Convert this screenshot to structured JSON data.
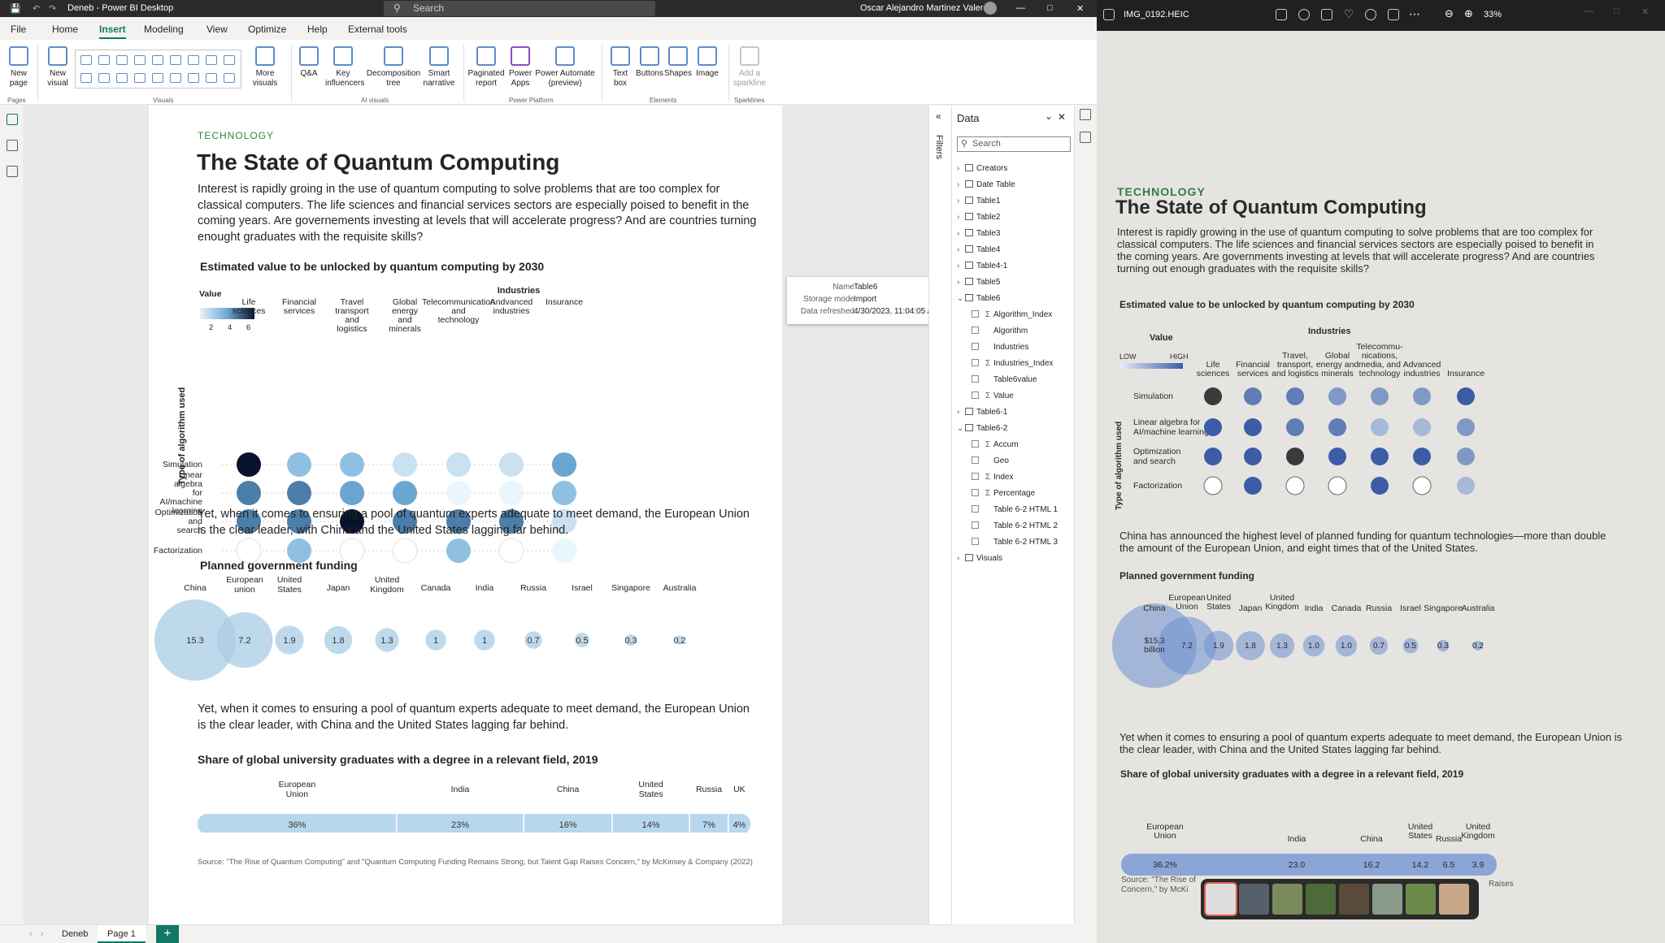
{
  "app": {
    "title": "Deneb - Power BI Desktop",
    "search_placeholder": "Search",
    "user": "Oscar Alejandro Martinez Valero"
  },
  "menu": [
    "File",
    "Home",
    "Insert",
    "Modeling",
    "View",
    "Optimize",
    "Help",
    "External tools"
  ],
  "active_menu": "Insert",
  "ribbon": {
    "new_page": "New page",
    "new_visual": "New visual",
    "more_visuals": "More visuals",
    "qa": "Q&A",
    "key_influencers": "Key influencers",
    "decomposition_tree": "Decomposition tree",
    "smart_narrative": "Smart narrative",
    "paginated_report": "Paginated report",
    "power_apps": "Power Apps",
    "power_automate": "Power Automate (preview)",
    "text_box": "Text box",
    "buttons": "Buttons",
    "shapes": "Shapes",
    "image": "Image",
    "add_sparkline": "Add a sparkline",
    "groups": {
      "pages": "Pages",
      "visuals": "Visuals",
      "ai_visuals": "AI visuals",
      "power_platform": "Power Platform",
      "elements": "Elements",
      "sparklines": "Sparklines"
    }
  },
  "report": {
    "kicker": "TECHNOLOGY",
    "title": "The State of Quantum Computing",
    "intro": "Interest is rapidly groing in the use of quantum computing to solve problems that are too complex for classical computers. The life sciences and financial services sectors are especially poised to benefit in the coming years. Are governements investing at levels that will accelerate progress? And are countries turning enought graduates with the requisite skills?",
    "heatmap_title": "Estimated value to be unlocked by quantum computing by 2030",
    "heatmap_legend_title": "Value",
    "heatmap_legend_ticks": [
      "2",
      "4",
      "6"
    ],
    "industries_label": "Industries",
    "algorithm_axis_label": "Type of algorithm used",
    "para1": "Yet, when it comes to ensuring a pool of quantum experts adequate to meet demand, the European Union is the clear leader, with China and the United States lagging far behind.",
    "funding_title": "Planned government funding",
    "para2": "Yet, when it comes to ensuring a pool of quantum experts adequate to meet demand, the European Union is the clear leader, with China and the United States lagging far behind.",
    "grads_title": "Share of global university graduates with a degree in a relevant field, 2019",
    "source": "Source: \"The Rise of Quantum Computing\" and \"Quantum Computing Funding Remains Strong, but Talent Gap Raises Concern,\" by McKinsey & Company (2022)"
  },
  "chart_data": [
    {
      "type": "heatmap",
      "title": "Estimated value to be unlocked by quantum computing by 2030",
      "x": [
        "Life sciences",
        "Financial services",
        "Travel transport and logistics",
        "Global energy and minerals",
        "Telecommunication and technology",
        "Andvanced industries",
        "Insurance"
      ],
      "y": [
        "Simulation",
        "Linear algebra for AI/machine learning",
        "Optimization and search",
        "Factorization"
      ],
      "values": [
        [
          7,
          3,
          3,
          2,
          2,
          2,
          4
        ],
        [
          5,
          5,
          4,
          4,
          1,
          1,
          3
        ],
        [
          5,
          5,
          7,
          5,
          5,
          5,
          2
        ],
        [
          0,
          3,
          0,
          0,
          3,
          0,
          1
        ]
      ],
      "legend": "Value"
    },
    {
      "type": "bubble",
      "title": "Planned government funding",
      "categories": [
        "China",
        "European union",
        "United States",
        "Japan",
        "United Kingdom",
        "Canada",
        "India",
        "Russia",
        "Israel",
        "Singapore",
        "Australia"
      ],
      "values": [
        15.3,
        7.2,
        1.9,
        1.8,
        1.3,
        1,
        1,
        0.7,
        0.5,
        0.3,
        0.2
      ],
      "labels": [
        "15.3",
        "7.2",
        "1.9",
        "1.8",
        "1.3",
        "1",
        "1",
        "0.7",
        "0.5",
        "0.3",
        "0.2"
      ]
    },
    {
      "type": "bar",
      "title": "Share of global university graduates with a degree in a relevant field, 2019",
      "categories": [
        "European Union",
        "India",
        "China",
        "United States",
        "Russia",
        "UK"
      ],
      "values": [
        36,
        23,
        16,
        14,
        7,
        4
      ],
      "labels": [
        "36%",
        "23%",
        "16%",
        "14%",
        "7%",
        "4%"
      ]
    }
  ],
  "tooltip": {
    "name_label": "Name",
    "name_value": "Table6",
    "storage_label": "Storage mode",
    "storage_value": "Import",
    "refreshed_label": "Data refreshed",
    "refreshed_value": "4/30/2023, 11:04:05 AM"
  },
  "filters_label": "Filters",
  "data_pane": {
    "title": "Data",
    "search_placeholder": "Search",
    "tables": [
      {
        "label": "Creators",
        "expanded": false
      },
      {
        "label": "Date Table",
        "expanded": false
      },
      {
        "label": "Table1",
        "expanded": false
      },
      {
        "label": "Table2",
        "expanded": false
      },
      {
        "label": "Table3",
        "expanded": false
      },
      {
        "label": "Table4",
        "expanded": false
      },
      {
        "label": "Table4-1",
        "expanded": false
      },
      {
        "label": "Table5",
        "expanded": false
      },
      {
        "label": "Table6",
        "expanded": true
      }
    ],
    "table6_fields": [
      {
        "label": "Algorithm_Index",
        "sigma": true
      },
      {
        "label": "Algorithm",
        "sigma": false
      },
      {
        "label": "Industries",
        "sigma": false
      },
      {
        "label": "Industries_Index",
        "sigma": true
      },
      {
        "label": "Table6value",
        "sigma": false
      },
      {
        "label": "Value",
        "sigma": true
      }
    ],
    "tables_after": [
      {
        "label": "Table6-1",
        "expanded": false
      },
      {
        "label": "Table6-2",
        "expanded": true
      }
    ],
    "table62_fields": [
      {
        "label": "Accum",
        "sigma": true
      },
      {
        "label": "Geo",
        "sigma": false
      },
      {
        "label": "Index",
        "sigma": true
      },
      {
        "label": "Percentage",
        "sigma": true
      },
      {
        "label": "Table 6-2 HTML 1",
        "sigma": false
      },
      {
        "label": "Table 6-2 HTML 2",
        "sigma": false
      },
      {
        "label": "Table 6-2 HTML 3",
        "sigma": false
      }
    ],
    "visuals": "Visuals"
  },
  "pages": {
    "tabs": [
      "Deneb",
      "Page 1"
    ],
    "active": "Page 1",
    "add": "+"
  },
  "photo": {
    "filename": "IMG_0192.HEIC",
    "zoom": "33%",
    "kicker": "TECHNOLOGY",
    "title": "The State of Quantum Computing",
    "intro": "Interest is rapidly growing in the use of quantum computing to solve problems that are too complex for classical computers. The life sciences and financial services sectors are especially poised to benefit in the coming years. Are governments investing at levels that will accelerate progress? And are countries turning out enough graduates with the requisite skills?",
    "heat_title": "Estimated value to be unlocked by quantum computing by 2030",
    "value": "Value",
    "industries": "Industries",
    "low": "LOW",
    "high": "HIGH",
    "axis": "Type of algorithm used",
    "cols": [
      "Life sciences",
      "Financial services",
      "Travel, transport, and logistics",
      "Global energy and minerals",
      "Telecommu-nications, media, and technology",
      "Advanced industries",
      "Insurance"
    ],
    "rows": [
      "Simulation",
      "Linear algebra for AI/machine learning",
      "Optimization and search",
      "Factorization"
    ],
    "para1": "China has announced the highest level of planned funding for quantum technologies—more than double the amount of the European Union, and eight times that of the United States.",
    "fund_title": "Planned government funding",
    "fund_cats": [
      "China",
      "European Union",
      "United States",
      "Japan",
      "United Kingdom",
      "India",
      "Canada",
      "Russia",
      "Israel",
      "Singapore",
      "Australia"
    ],
    "fund_vals": [
      "$15.3 billion",
      "7.2",
      "1.9",
      "1.8",
      "1.3",
      "1.0",
      "1.0",
      "0.7",
      "0.5",
      "0.3",
      "0.2"
    ],
    "para2": "Yet when it comes to ensuring a pool of quantum experts adequate to meet demand, the European Union is the clear leader, with China and the United States lagging far behind.",
    "grad_title": "Share of global university graduates with a degree in a relevant field, 2019",
    "grad_cats": [
      "European Union",
      "India",
      "China",
      "United States",
      "Russia",
      "United Kingdom"
    ],
    "grad_vals": [
      "36.2%",
      "23.0",
      "16.2",
      "14.2",
      "6.5",
      "3.9"
    ],
    "source1": "Source: \"The Rise of",
    "source1b": "Raises",
    "source2": "Concern,\" by McKi"
  }
}
